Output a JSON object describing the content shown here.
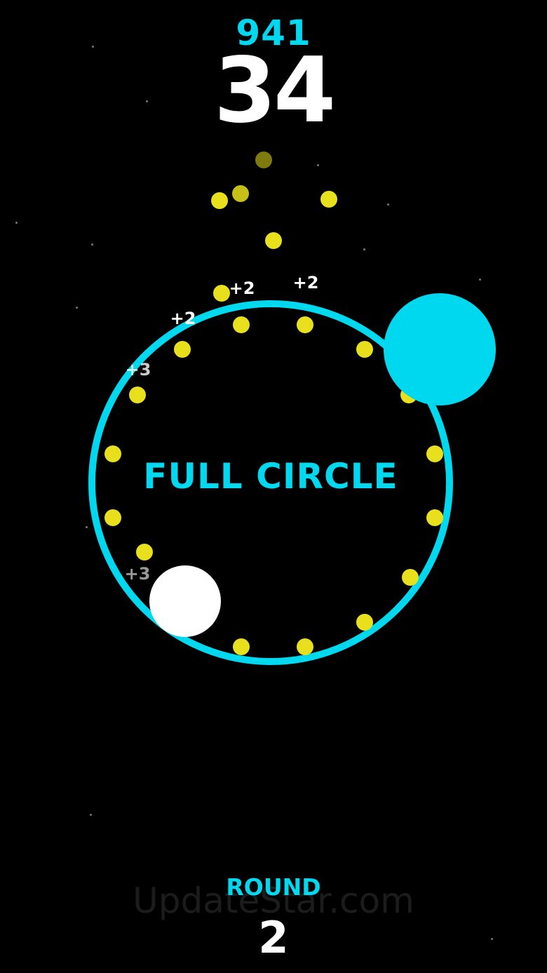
{
  "colors": {
    "accent": "#00d8f0",
    "coin": "#e8e01c",
    "player": "#ffffff",
    "background": "#000000"
  },
  "hud": {
    "best_score": "941",
    "score": "34"
  },
  "message": "FULL CIRCLE",
  "round": {
    "label": "ROUND",
    "value": "2"
  },
  "point_popups": [
    "+2",
    "+2",
    "+2",
    "+3",
    "+3"
  ],
  "watermark": "UpdateStar.com"
}
